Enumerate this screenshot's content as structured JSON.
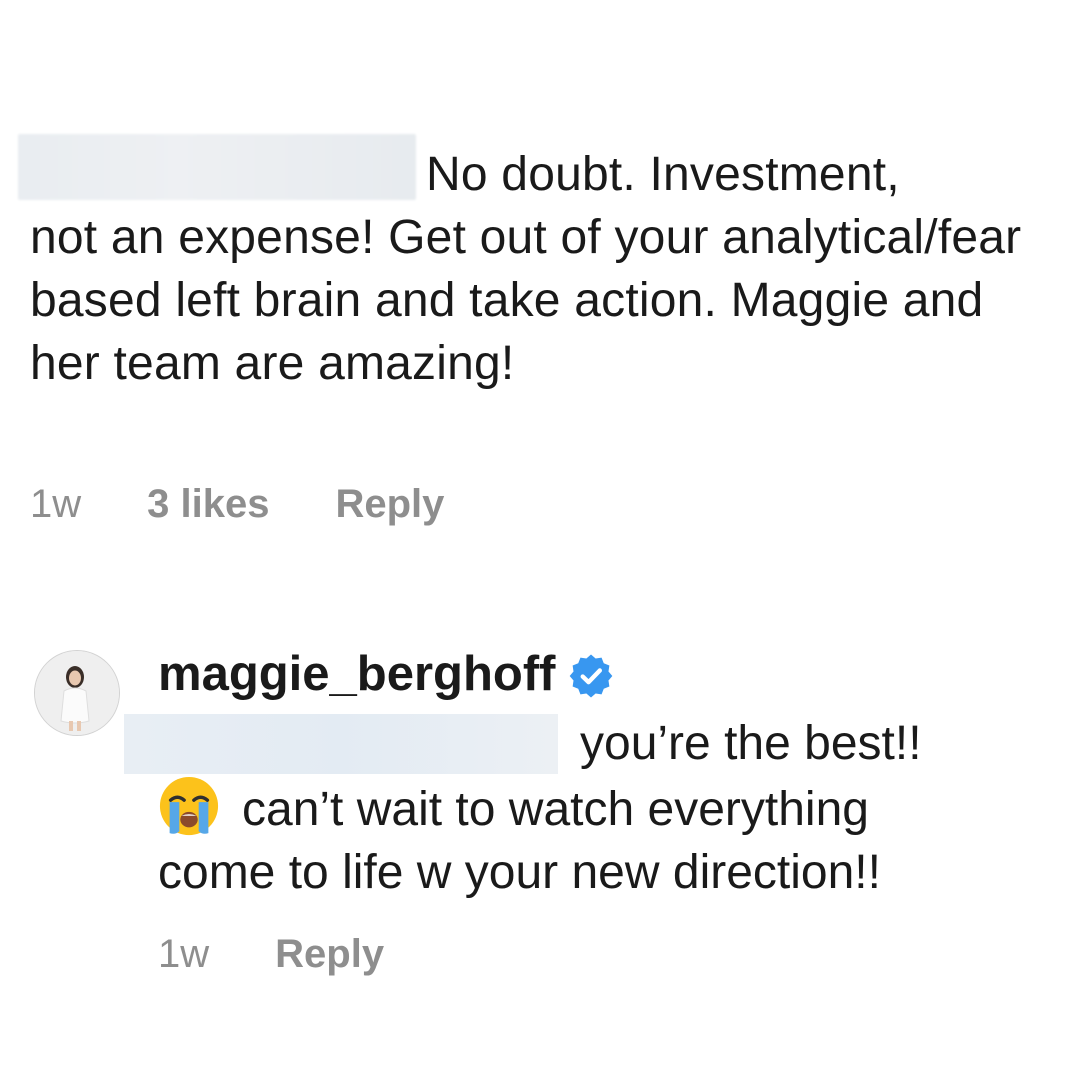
{
  "comments": [
    {
      "text_line1": "No doubt. Investment,",
      "text_rest": "not an expense! Get out of your analytical/fear based left brain and take action. Maggie and her team are amazing!",
      "time": "1w",
      "likes": "3 likes",
      "reply_label": "Reply"
    },
    {
      "username": "maggie_berghoff",
      "text_line1": "you’re the best!!",
      "text_line2": "can’t wait to watch everything",
      "text_line3": "come to life w your new direction!!",
      "emoji": "loudly-crying-face",
      "time": "1w",
      "reply_label": "Reply"
    }
  ],
  "colors": {
    "text": "#1a1a1a",
    "meta": "#8e8e8e",
    "verified_badge": "#3897f0"
  },
  "icons": [
    "verified-badge-icon",
    "loudly-crying-face-emoji"
  ]
}
